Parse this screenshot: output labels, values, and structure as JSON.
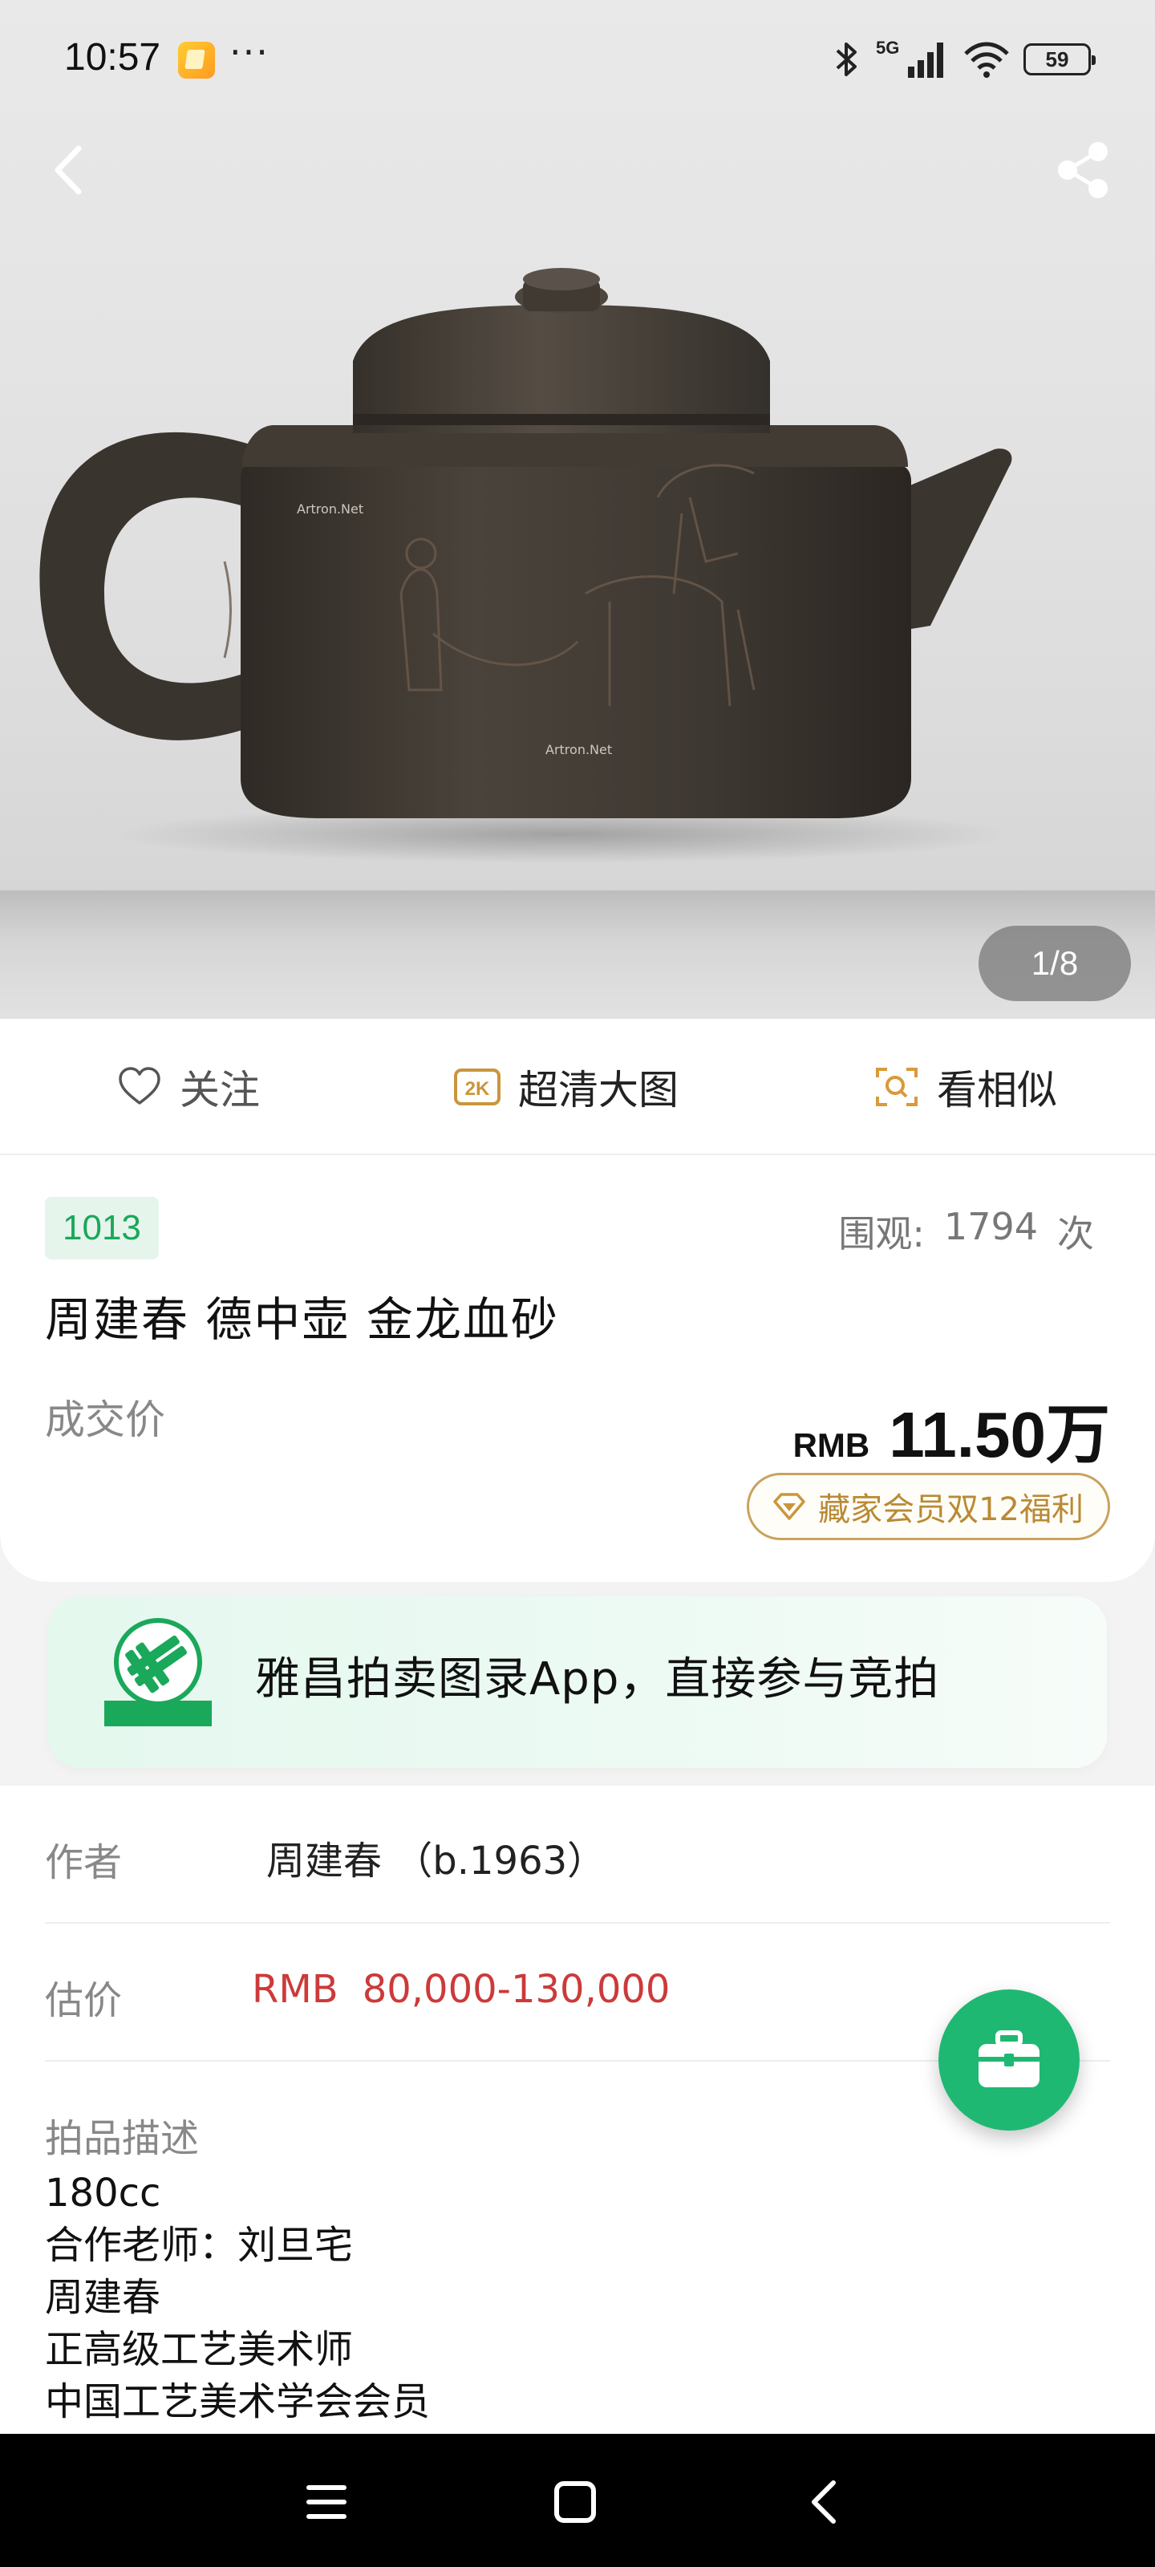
{
  "status_bar": {
    "time": "10:57",
    "dots": "···",
    "network": "5G",
    "battery": "59"
  },
  "hero": {
    "counter": "1/8",
    "watermark": "Artron.Net"
  },
  "actions": {
    "follow": "关注",
    "hd_badge": "2K",
    "hd": "超清大图",
    "similar": "看相似"
  },
  "lot": {
    "number": "1013",
    "views_label": "围观:",
    "views_count": "1794",
    "views_unit": "次",
    "title": "周建春 德中壶 金龙血砂",
    "deal_label": "成交价",
    "deal_currency": "RMB",
    "deal_price": "11.50万",
    "member_promo": "藏家会员双12福利"
  },
  "promo": {
    "text": "雅昌拍卖图录App，直接参与竞拍"
  },
  "details": {
    "author_label": "作者",
    "author_value": "周建春 （b.1963）",
    "estimate_label": "估价",
    "estimate_currency": "RMB",
    "estimate_range": "80,000-130,000",
    "description_title": "拍品描述",
    "description_lines": [
      "180cc",
      "合作老师：刘旦宅",
      "周建春",
      "正高级工艺美术师",
      "中国工艺美术学会会员"
    ]
  },
  "colors": {
    "accent_green": "#1fb872",
    "price_red": "#cc3a3a",
    "gold": "#c9a25c"
  }
}
